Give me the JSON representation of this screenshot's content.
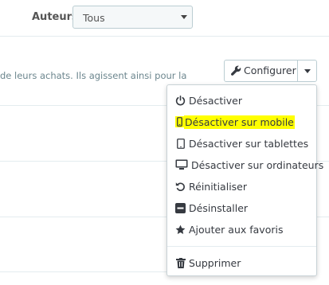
{
  "filter": {
    "label": "Auteurs",
    "selected": "Tous"
  },
  "description": "de leurs achats. Ils agissent ainsi pour la",
  "configure_button": {
    "label": "Configurer"
  },
  "menu": {
    "items": [
      {
        "label": "Désactiver",
        "icon": "power-icon"
      },
      {
        "label": "Désactiver sur mobile",
        "icon": "mobile-icon",
        "highlight": "#ffff00"
      },
      {
        "label": "Désactiver sur tablettes",
        "icon": "tablet-icon"
      },
      {
        "label": "Désactiver sur ordinateurs",
        "icon": "desktop-icon"
      },
      {
        "label": "Réinitialiser",
        "icon": "undo-icon"
      },
      {
        "label": "Désinstaller",
        "icon": "minus-square-icon"
      },
      {
        "label": "Ajouter aux favoris",
        "icon": "star-icon"
      },
      {
        "label": "Supprimer",
        "icon": "trash-icon"
      }
    ]
  }
}
